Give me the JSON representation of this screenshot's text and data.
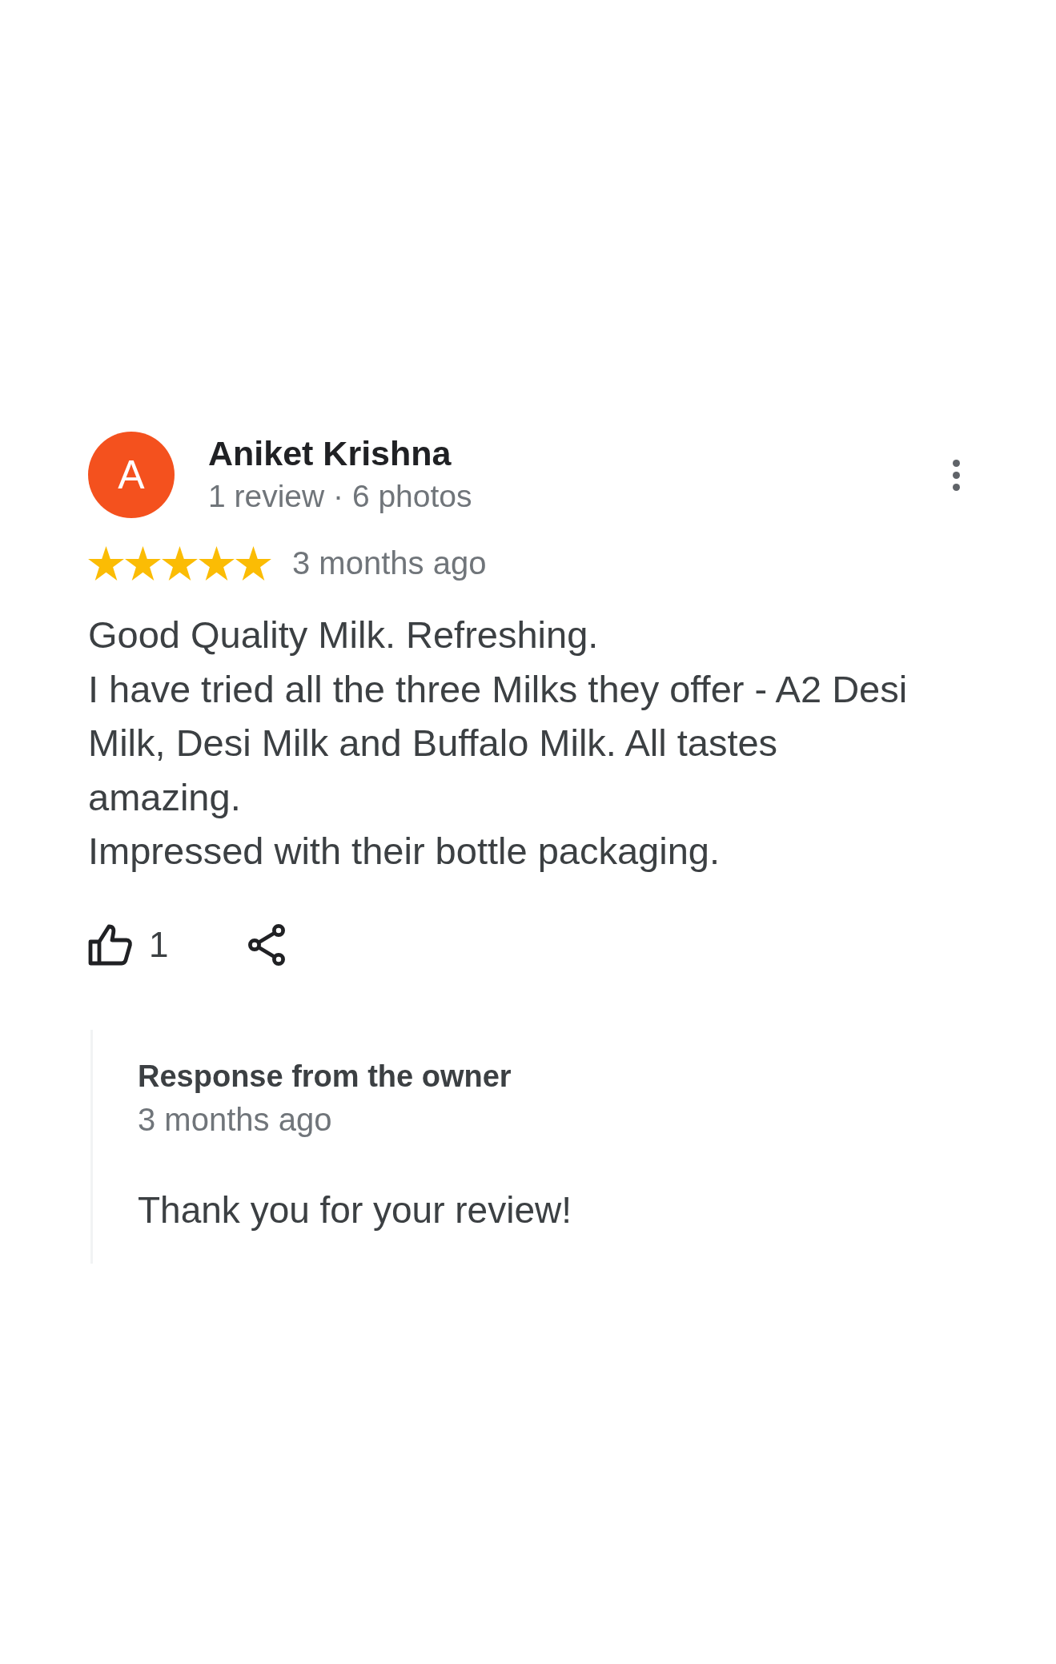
{
  "review": {
    "author": {
      "initial": "A",
      "name": "Aniket Krishna",
      "meta": "1 review · 6 photos"
    },
    "stars": 5,
    "time": "3 months ago",
    "text": "Good Quality Milk. Refreshing.\nI have tried all the three Milks they offer - A2 Desi Milk, Desi Milk and Buffalo Milk. All tastes amazing.\nImpressed with their bottle packaging.",
    "likes": "1"
  },
  "owner_response": {
    "title": "Response from the owner",
    "time": "3 months ago",
    "text": "Thank you for your review!"
  }
}
